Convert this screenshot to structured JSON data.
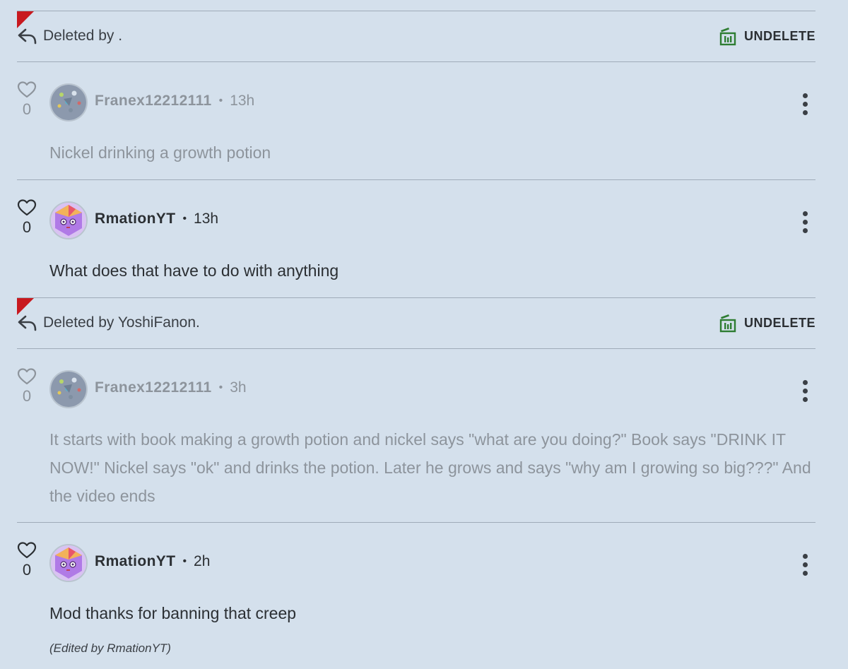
{
  "deleted_bars": [
    {
      "text": "Deleted by .",
      "action": "UNDELETE"
    },
    {
      "text": "Deleted by YoshiFanon.",
      "action": "UNDELETE"
    }
  ],
  "comments": [
    {
      "user": "Franex12212111",
      "time": "13h",
      "votes": "0",
      "body": "Nickel drinking a growth potion",
      "avatar": "franex-avatar"
    },
    {
      "user": "RmationYT",
      "time": "13h",
      "votes": "0",
      "body": "What does that have to do with anything",
      "avatar": "rmation-avatar"
    },
    {
      "user": "Franex12212111",
      "time": "3h",
      "votes": "0",
      "body": "It starts with book making a growth potion and nickel says \"what are you doing?\" Book says \"DRINK IT NOW!\" Nickel says \"ok\" and drinks the potion. Later he grows and says \"why am I growing so big???\" And the video ends",
      "avatar": "franex-avatar"
    },
    {
      "user": "RmationYT",
      "time": "2h",
      "votes": "0",
      "body": "Mod thanks for banning that creep",
      "edited": "(Edited by RmationYT)",
      "avatar": "rmation-avatar"
    }
  ],
  "colors": {
    "background": "#d4e0ec",
    "delete_flag": "#c8191f",
    "undelete_icon": "#2e7d32"
  }
}
